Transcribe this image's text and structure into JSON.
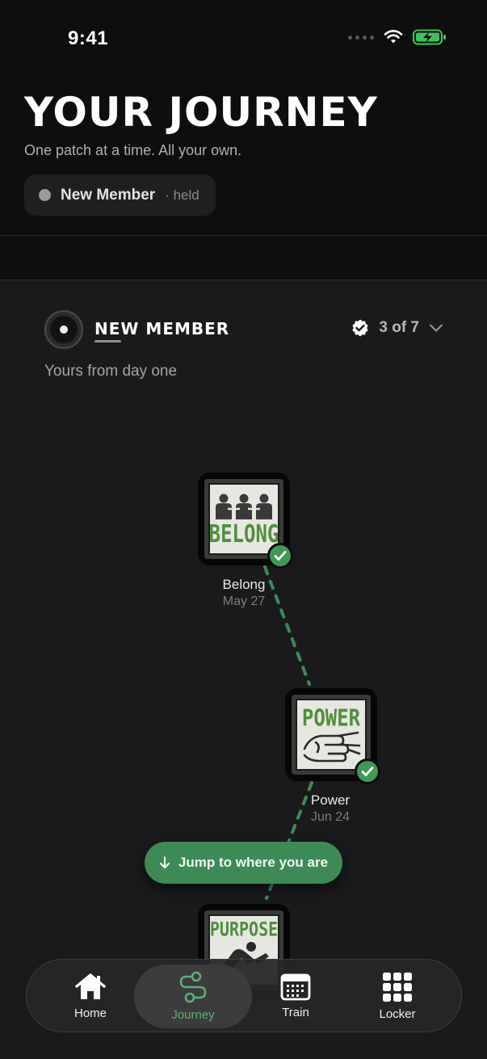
{
  "status_bar": {
    "time": "9:41"
  },
  "header": {
    "title": "YOUR JOURNEY",
    "subtitle": "One patch at a time. All your own.",
    "rank_pill": {
      "name": "New Member",
      "state": "· held"
    }
  },
  "rank": {
    "title": "NEW MEMBER",
    "progress": "3 of 7",
    "tagline": "Yours from day one"
  },
  "patches": [
    {
      "label": "Belong",
      "date": "May 27",
      "word": "BELONG",
      "earned": true
    },
    {
      "label": "Power",
      "date": "Jun 24",
      "word": "POWER",
      "earned": true
    },
    {
      "label": "Purpose",
      "date": "",
      "word": "PURPOSE",
      "earned": true
    }
  ],
  "jump_button": {
    "label": "Jump to where you are"
  },
  "tabs": [
    {
      "label": "Home",
      "icon": "home-icon",
      "active": false
    },
    {
      "label": "Journey",
      "icon": "route-icon",
      "active": true
    },
    {
      "label": "Train",
      "icon": "calendar-icon",
      "active": false
    },
    {
      "label": "Locker",
      "icon": "grid-icon",
      "active": false
    }
  ],
  "colors": {
    "accent_green": "#3d8a56",
    "active_tab_text": "#5fae73",
    "background": "#0e0e0f"
  }
}
